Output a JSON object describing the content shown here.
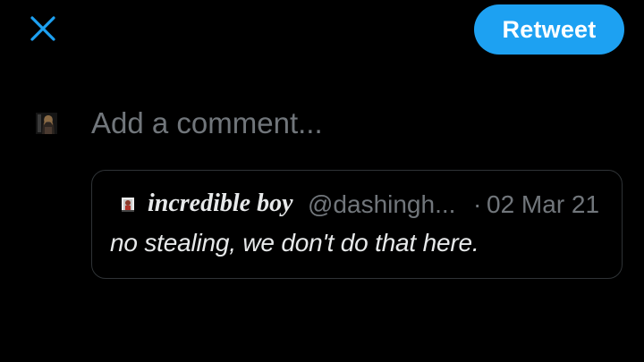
{
  "header": {
    "close_icon": "close-x-icon",
    "retweet_label": "Retweet",
    "accent_color": "#1da1f2"
  },
  "composer": {
    "avatar_icon": "user-avatar",
    "placeholder": "Add a comment..."
  },
  "quoted_tweet": {
    "display_name": "incredible boy",
    "handle": "@dashingh...",
    "separator": "·",
    "date": "02 Mar 21",
    "text": "no stealing, we don't do that here."
  }
}
